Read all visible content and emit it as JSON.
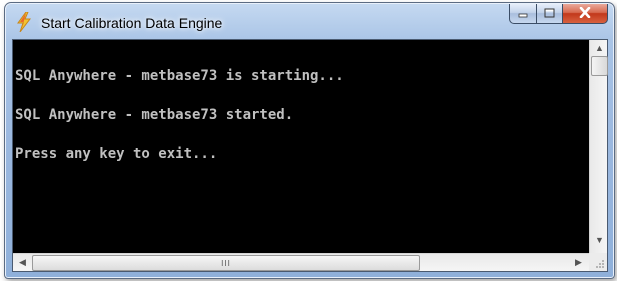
{
  "window": {
    "title": "Start Calibration Data Engine",
    "icon": "lightning-bolt-icon",
    "buttons": {
      "minimize": "minimize-icon",
      "maximize": "maximize-icon",
      "close": "close-icon"
    }
  },
  "console": {
    "lines": [
      "SQL Anywhere - metbase73 is starting...",
      "SQL Anywhere - metbase73 started.",
      "Press any key to exit..."
    ],
    "background": "#000000",
    "foreground": "#c0c0c0"
  },
  "scrollbars": {
    "vertical_up": "▲",
    "vertical_down": "▼",
    "horizontal_left": "◀",
    "horizontal_right": "▶",
    "grip": "III"
  },
  "colors": {
    "close_button": "#c2381b",
    "frame": "#9bb8df"
  }
}
